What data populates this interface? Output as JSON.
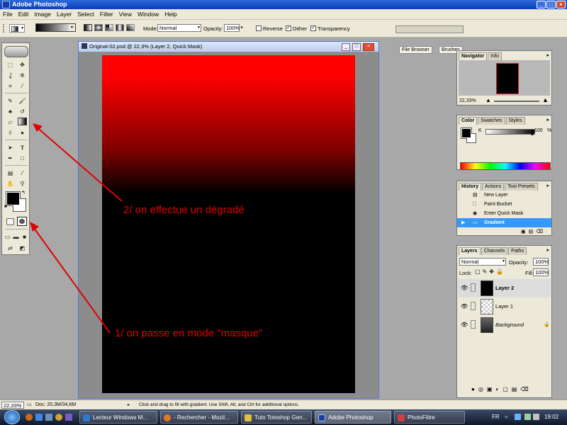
{
  "window": {
    "title": "Adobe Photoshop"
  },
  "menu": [
    "File",
    "Edit",
    "Image",
    "Layer",
    "Select",
    "Filter",
    "View",
    "Window",
    "Help"
  ],
  "options": {
    "mode_label": "Mode:",
    "mode_value": "Normal",
    "opacity_label": "Opacity:",
    "opacity_value": "100%",
    "reverse_label": "Reverse",
    "dither_label": "Dither",
    "transparency_label": "Transparency",
    "file_browser": "File Browser",
    "brushes": "Brushes"
  },
  "document": {
    "title": "Original-02.psd @ 22,3% (Layer 2, Quick Mask)"
  },
  "navigator": {
    "tabs": [
      "Navigator",
      "Info"
    ],
    "zoom": "22,33%"
  },
  "color": {
    "tabs": [
      "Color",
      "Swatches",
      "Styles"
    ],
    "channel": "K",
    "value": "100",
    "unit": "%"
  },
  "history": {
    "tabs": [
      "History",
      "Actions",
      "Tool Presets"
    ],
    "items": [
      "New Layer",
      "Paint Bucket",
      "Enter Quick Mask",
      "Gradient"
    ]
  },
  "layers": {
    "tabs": [
      "Layers",
      "Channels",
      "Paths"
    ],
    "blend": "Normal",
    "opacity_label": "Opacity:",
    "opacity": "100%",
    "lock_label": "Lock:",
    "fill_label": "Fill:",
    "fill": "100%",
    "items": [
      "Layer 2",
      "Layer 1",
      "Background"
    ]
  },
  "status": {
    "zoom": "22,33%",
    "doc": "Doc: 20,3M/34,6M",
    "hint": "Click and drag to fill with gradient.  Use Shift, Alt, and Ctrl for additional options."
  },
  "taskbar": {
    "tasks": [
      "Lecteur Windows M...",
      "- Rechercher - Mozil...",
      "Tuto Totoshop Gen...",
      "Adobe Photoshop",
      "PhotoFiltre"
    ],
    "lang": "FR",
    "clock": "19:02"
  },
  "annotations": {
    "step2": "2/ on effectue un dégradé",
    "step1": "1/ on passe en mode \"masque\""
  },
  "colors": {
    "accent": "#e00000",
    "titlebar": "#0a3fb8",
    "selection": "#3399ff"
  }
}
